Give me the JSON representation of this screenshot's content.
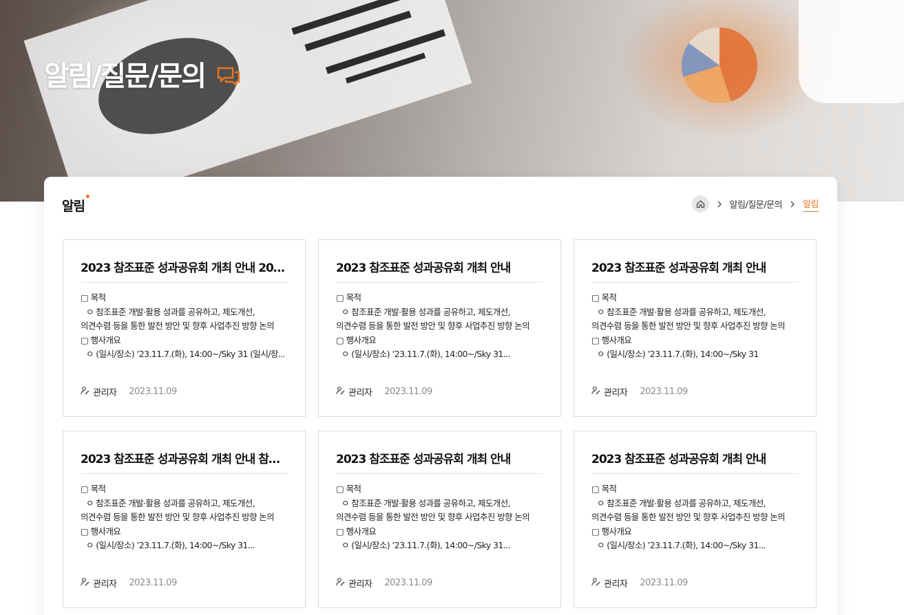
{
  "hero": {
    "title": "알림/질문/문의",
    "icon": "chat-bubbles-icon"
  },
  "accent_color": "#e8761f",
  "section": {
    "title": "알림"
  },
  "breadcrumb": {
    "home_icon": "home-icon",
    "items": [
      {
        "label": "알림/질문/문의"
      },
      {
        "label": "알림"
      }
    ]
  },
  "cards": [
    {
      "title": "2023 참조표준 성과공유회 개최 안내 202...",
      "lines": [
        "▢ 목적",
        "ㅇ 참조표준 개발·활용 성과를 공유하고, 제도개선,",
        "의견수렴 등을 통한 발전 방안 및 향후 사업추진 방향 논의",
        "▢ 행사개요",
        "ㅇ (일시/장소) ’23.11.7.(화), 14:00~/Sky 31 (일시/장..."
      ],
      "author": "관리자",
      "date": "2023.11.09"
    },
    {
      "title": "2023 참조표준 성과공유회 개최 안내",
      "lines": [
        "▢ 목적",
        "ㅇ 참조표준 개발·활용 성과를 공유하고, 제도개선,",
        "의견수렴 등을 통한 발전 방안 및 향후 사업추진 방향 논의",
        "▢ 행사개요",
        "ㅇ (일시/장소) ’23.11.7.(화), 14:00~/Sky 31..."
      ],
      "author": "관리자",
      "date": "2023.11.09"
    },
    {
      "title": "2023 참조표준 성과공유회 개최 안내",
      "lines": [
        "▢ 목적",
        "ㅇ 참조표준 개발·활용 성과를 공유하고, 제도개선,",
        "의견수렴 등을 통한 발전 방안 및 향후 사업추진 방향 논의",
        "▢ 행사개요",
        "ㅇ (일시/장소) ’23.11.7.(화), 14:00~/Sky 31"
      ],
      "author": "관리자",
      "date": "2023.11.09"
    },
    {
      "title": "2023 참조표준 성과공유회 개최 안내 참조표",
      "lines": [
        "▢ 목적",
        "ㅇ 참조표준 개발·활용 성과를 공유하고, 제도개선,",
        "의견수렴 등을 통한 발전 방안 및 향후 사업추진 방향 논의",
        "▢ 행사개요",
        "ㅇ (일시/장소) ’23.11.7.(화), 14:00~/Sky 31..."
      ],
      "author": "관리자",
      "date": "2023.11.09"
    },
    {
      "title": "2023 참조표준 성과공유회 개최 안내",
      "lines": [
        "▢ 목적",
        "ㅇ 참조표준 개발·활용 성과를 공유하고, 제도개선,",
        "의견수렴 등을 통한 발전 방안 및 향후 사업추진 방향 논의",
        "▢ 행사개요",
        "ㅇ (일시/장소) ’23.11.7.(화), 14:00~/Sky 31..."
      ],
      "author": "관리자",
      "date": "2023.11.09"
    },
    {
      "title": "2023 참조표준 성과공유회 개최 안내",
      "lines": [
        "▢ 목적",
        "ㅇ 참조표준 개발·활용 성과를 공유하고, 제도개선,",
        "의견수렴 등을 통한 발전 방안 및 향후 사업추진 방향 논의",
        "▢ 행사개요",
        "ㅇ (일시/장소) ’23.11.7.(화), 14:00~/Sky 31..."
      ],
      "author": "관리자",
      "date": "2023.11.09"
    }
  ]
}
